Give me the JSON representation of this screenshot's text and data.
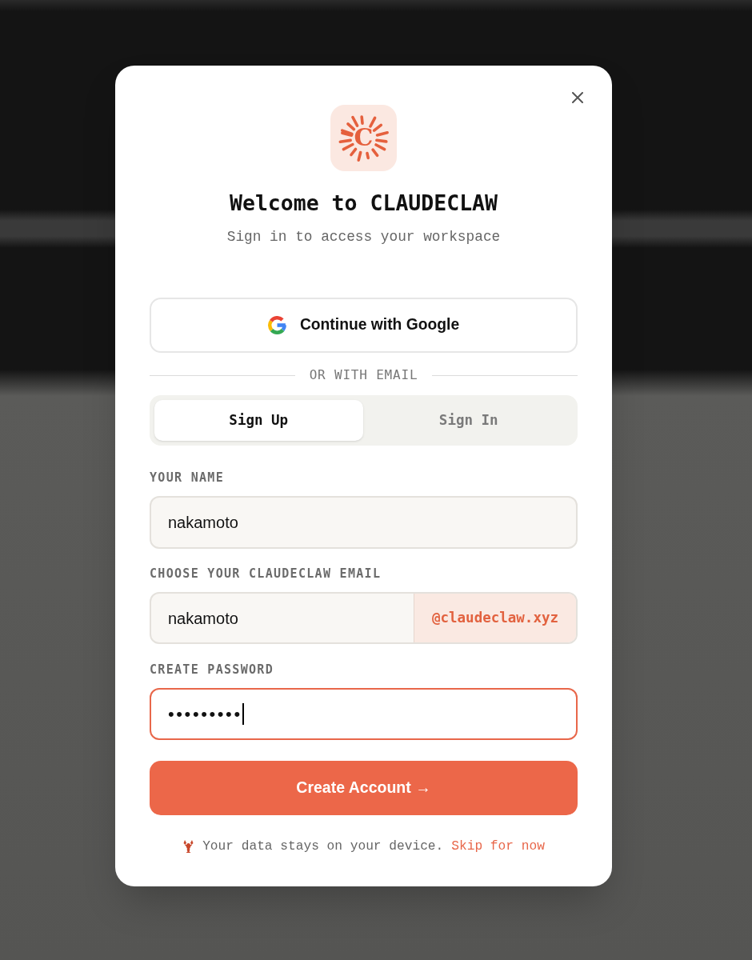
{
  "header": {
    "logo_letter": "C",
    "title": "Welcome to CLAUDECLAW",
    "subtitle": "Sign in to access your workspace"
  },
  "google_button": {
    "label": "Continue with Google"
  },
  "divider": {
    "label": "OR WITH EMAIL"
  },
  "tabs": [
    {
      "label": "Sign Up",
      "selected": true
    },
    {
      "label": "Sign In",
      "selected": false
    }
  ],
  "fields": [
    {
      "kind": "text",
      "label": "YOUR NAME",
      "value": "nakamoto",
      "focused": false
    },
    {
      "kind": "email",
      "label": "CHOOSE YOUR CLAUDECLAW EMAIL",
      "value": "nakamoto",
      "suffix": "@claudeclaw.xyz",
      "focused": false
    },
    {
      "kind": "password",
      "label": "CREATE PASSWORD",
      "value": "•••••••••",
      "focused": true
    }
  ],
  "submit_button": {
    "label": "Create Account →"
  },
  "footer": {
    "note": "Your data stays on your device.",
    "link": "Skip for now"
  }
}
